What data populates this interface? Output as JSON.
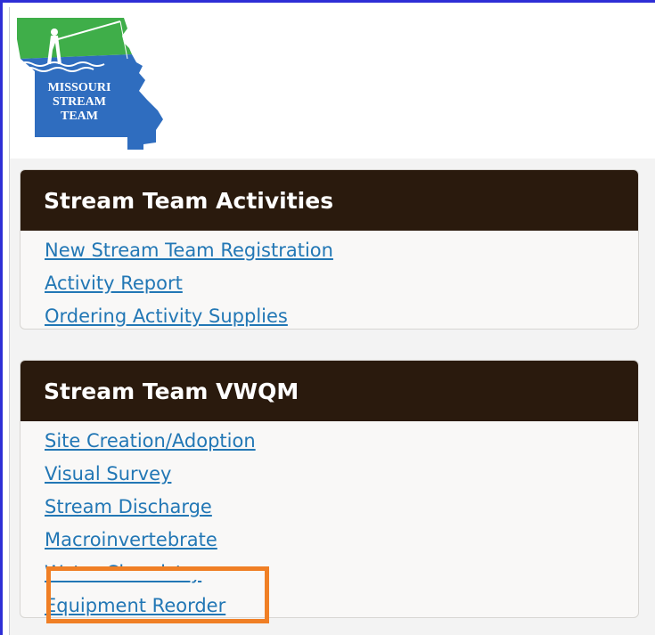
{
  "logo": {
    "line1": "MISSOURI",
    "line2": "STREAM",
    "line3": "TEAM",
    "icon": "fisherman-icon",
    "colors": {
      "green": "#3fae49",
      "blue": "#2f6dbf",
      "dark_blue": "#1f4fa0"
    }
  },
  "panels": [
    {
      "title": "Stream Team Activities",
      "links": [
        "New Stream Team Registration",
        "Activity Report",
        "Ordering Activity Supplies"
      ]
    },
    {
      "title": "Stream Team VWQM",
      "links": [
        "Site Creation/Adoption",
        "Visual Survey",
        "Stream Discharge",
        "Macroinvertebrate",
        "Water Chemistry",
        "Equipment Reorder"
      ]
    }
  ],
  "colors": {
    "panel_header": "#2a1a0d",
    "link": "#2277b5",
    "highlight": "#f07f25",
    "frame": "#2e2ed6"
  }
}
